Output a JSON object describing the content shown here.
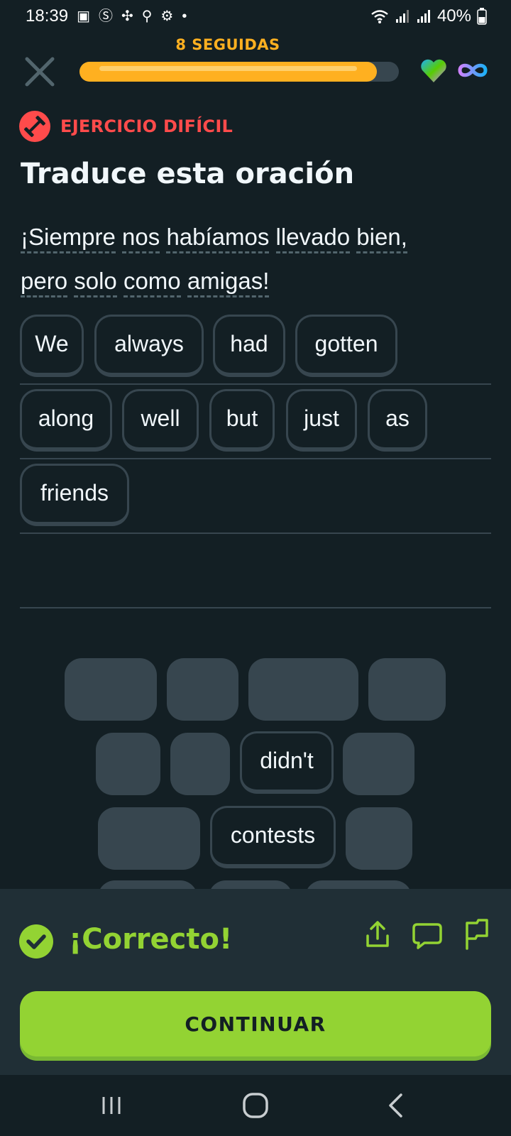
{
  "status_bar": {
    "time": "18:39",
    "battery": "40%"
  },
  "header": {
    "streak_label": "8 SEGUIDAS",
    "progress_fraction": 0.93,
    "colors": {
      "streak": "#ffb020",
      "track": "#37464f"
    }
  },
  "exercise": {
    "badge_label": "EJERCICIO DIFÍCIL",
    "title": "Traduce esta oración",
    "prompt_words": [
      "¡Siempre",
      "nos",
      "habíamos",
      "llevado",
      "bien,",
      "pero",
      "solo",
      "como",
      "amigas!"
    ]
  },
  "answer": {
    "words": [
      "We",
      "always",
      "had",
      "gotten",
      "along",
      "well",
      "but",
      "just",
      "as",
      "friends"
    ]
  },
  "word_bank": {
    "remaining_words": [
      "didn't",
      "contests"
    ]
  },
  "feedback": {
    "result_label": "¡Correcto!",
    "continue_label": "CONTINUAR",
    "colors": {
      "correct": "#93d333",
      "error": "#ff4b4b"
    }
  },
  "icons": [
    "close-icon",
    "heart-icon",
    "infinity-icon",
    "dumbbell-icon",
    "check-circle-icon",
    "share-icon",
    "comment-icon",
    "flag-icon"
  ]
}
